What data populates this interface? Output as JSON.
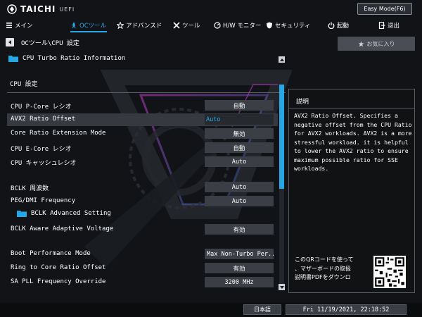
{
  "header": {
    "brand": "TAICHI",
    "brand_sub": "UEFI",
    "easy_mode_label": "Easy Mode(F6)"
  },
  "tabs": [
    {
      "label": "メイン",
      "icon": "list-icon"
    },
    {
      "label": "OCツール",
      "icon": "rocket-icon",
      "active": true
    },
    {
      "label": "アドバンスド",
      "icon": "star-icon"
    },
    {
      "label": "ツール",
      "icon": "tools-icon"
    },
    {
      "label": "H/W モニター",
      "icon": "monitor-icon"
    },
    {
      "label": "セキュリティ",
      "icon": "shield-icon"
    },
    {
      "label": "起動",
      "icon": "power-icon"
    },
    {
      "label": "退出",
      "icon": "exit-icon"
    }
  ],
  "breadcrumb": "OCツール\\CPU 設定",
  "favorites_label": "お気に入り",
  "turbo_ratio_label": "CPU Turbo Ratio Information",
  "section_title": "CPU 設定",
  "settings": [
    {
      "label": "CPU P-Core レシオ",
      "value": "自動"
    },
    {
      "label": "AVX2 Ratio Offset",
      "value": "Auto",
      "selected": true
    },
    {
      "label": "Core Ratio Extension Mode",
      "value": "無効"
    },
    {
      "label": "CPU E-Core レシオ",
      "value": "自動"
    },
    {
      "label": "CPU  キャッシュレシオ",
      "value": "Auto"
    },
    {
      "label": "BCLK 周波数",
      "value": "Auto"
    },
    {
      "label": "PEG/DMI Frequency",
      "value": "Auto"
    },
    {
      "label": "BCLK Advanced Setting",
      "value": ""
    },
    {
      "label": "BCLK Aware Adaptive Voltage",
      "value": "有効"
    },
    {
      "label": "Boot Performance Mode",
      "value": "Max Non-Turbo Per..."
    },
    {
      "label": "Ring to Core Ratio Offset",
      "value": "有効"
    },
    {
      "label": "SA PLL Frequency Override",
      "value": "3200 MHz"
    }
  ],
  "description": {
    "title": "説明",
    "text": "AVX2 Ratio Offset. Specifies a negative offset from the CPU Ratio for AVX2 workloads. AVX2 is a more stressful workload. it is helpful to lower the AVX2 ratio to ensure maximum possible ratio for SSE workloads.",
    "qr_text": "このQRコードを使って\n、マザーボードの取扱\n説明書PDFをダウンロ"
  },
  "footer": {
    "language": "日本語",
    "datetime": "Fri 11/19/2021, 22:18:52"
  },
  "colors": {
    "accent": "#27a6e6",
    "background": "#101215",
    "value_box": "#3b3f45"
  },
  "scroll_position_fraction": 0.0
}
